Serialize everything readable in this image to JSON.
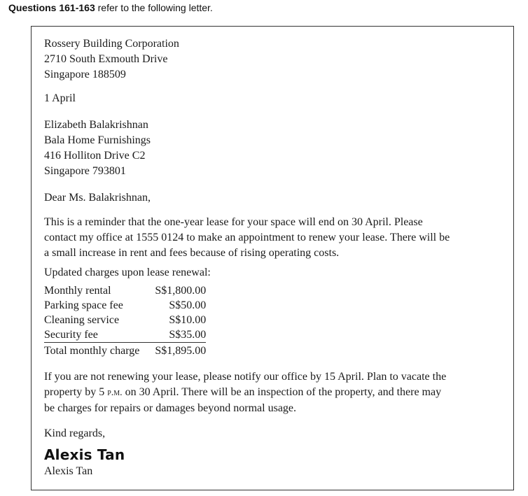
{
  "header": {
    "bold": "Questions 161-163",
    "rest": " refer to the following letter."
  },
  "sender": {
    "name": "Rossery Building Corporation",
    "street": "2710 South Exmouth Drive",
    "city": "Singapore 188509"
  },
  "date": "1 April",
  "recipient": {
    "name": "Elizabeth Balakrishnan",
    "company": "Bala Home Furnishings",
    "street": "416 Holliton Drive C2",
    "city": "Singapore 793801"
  },
  "salutation": "Dear Ms. Balakrishnan,",
  "body": {
    "p1_lines": [
      "This is a reminder that the one-year lease for your space will end on 30 April. Please",
      "contact my office at 1555 0124 to make an appointment to renew your lease. There will be",
      "a small increase in rent and fees because of rising operating costs."
    ],
    "charges_title": "Updated charges upon lease renewal:",
    "charges": [
      {
        "label": "Monthly rental",
        "amount": "S$1,800.00"
      },
      {
        "label": "Parking space fee",
        "amount": "S$50.00"
      },
      {
        "label": "Cleaning service",
        "amount": "S$10.00"
      },
      {
        "label": "Security fee",
        "amount": "S$35.00"
      }
    ],
    "total": {
      "label": "Total monthly charge",
      "amount": "S$1,895.00"
    },
    "p2": {
      "line1": "If you are not renewing your lease, please notify our office by 15 April. Plan to vacate the",
      "line2_pre": "property by 5 ",
      "line2_pm": "p.m.",
      "line2_post": " on 30 April. There will be an inspection of the property, and there may",
      "line3": "be charges for repairs or damages beyond normal usage."
    }
  },
  "closing": "Kind regards,",
  "signature": "Alexis Tan",
  "signer_name": "Alexis Tan"
}
